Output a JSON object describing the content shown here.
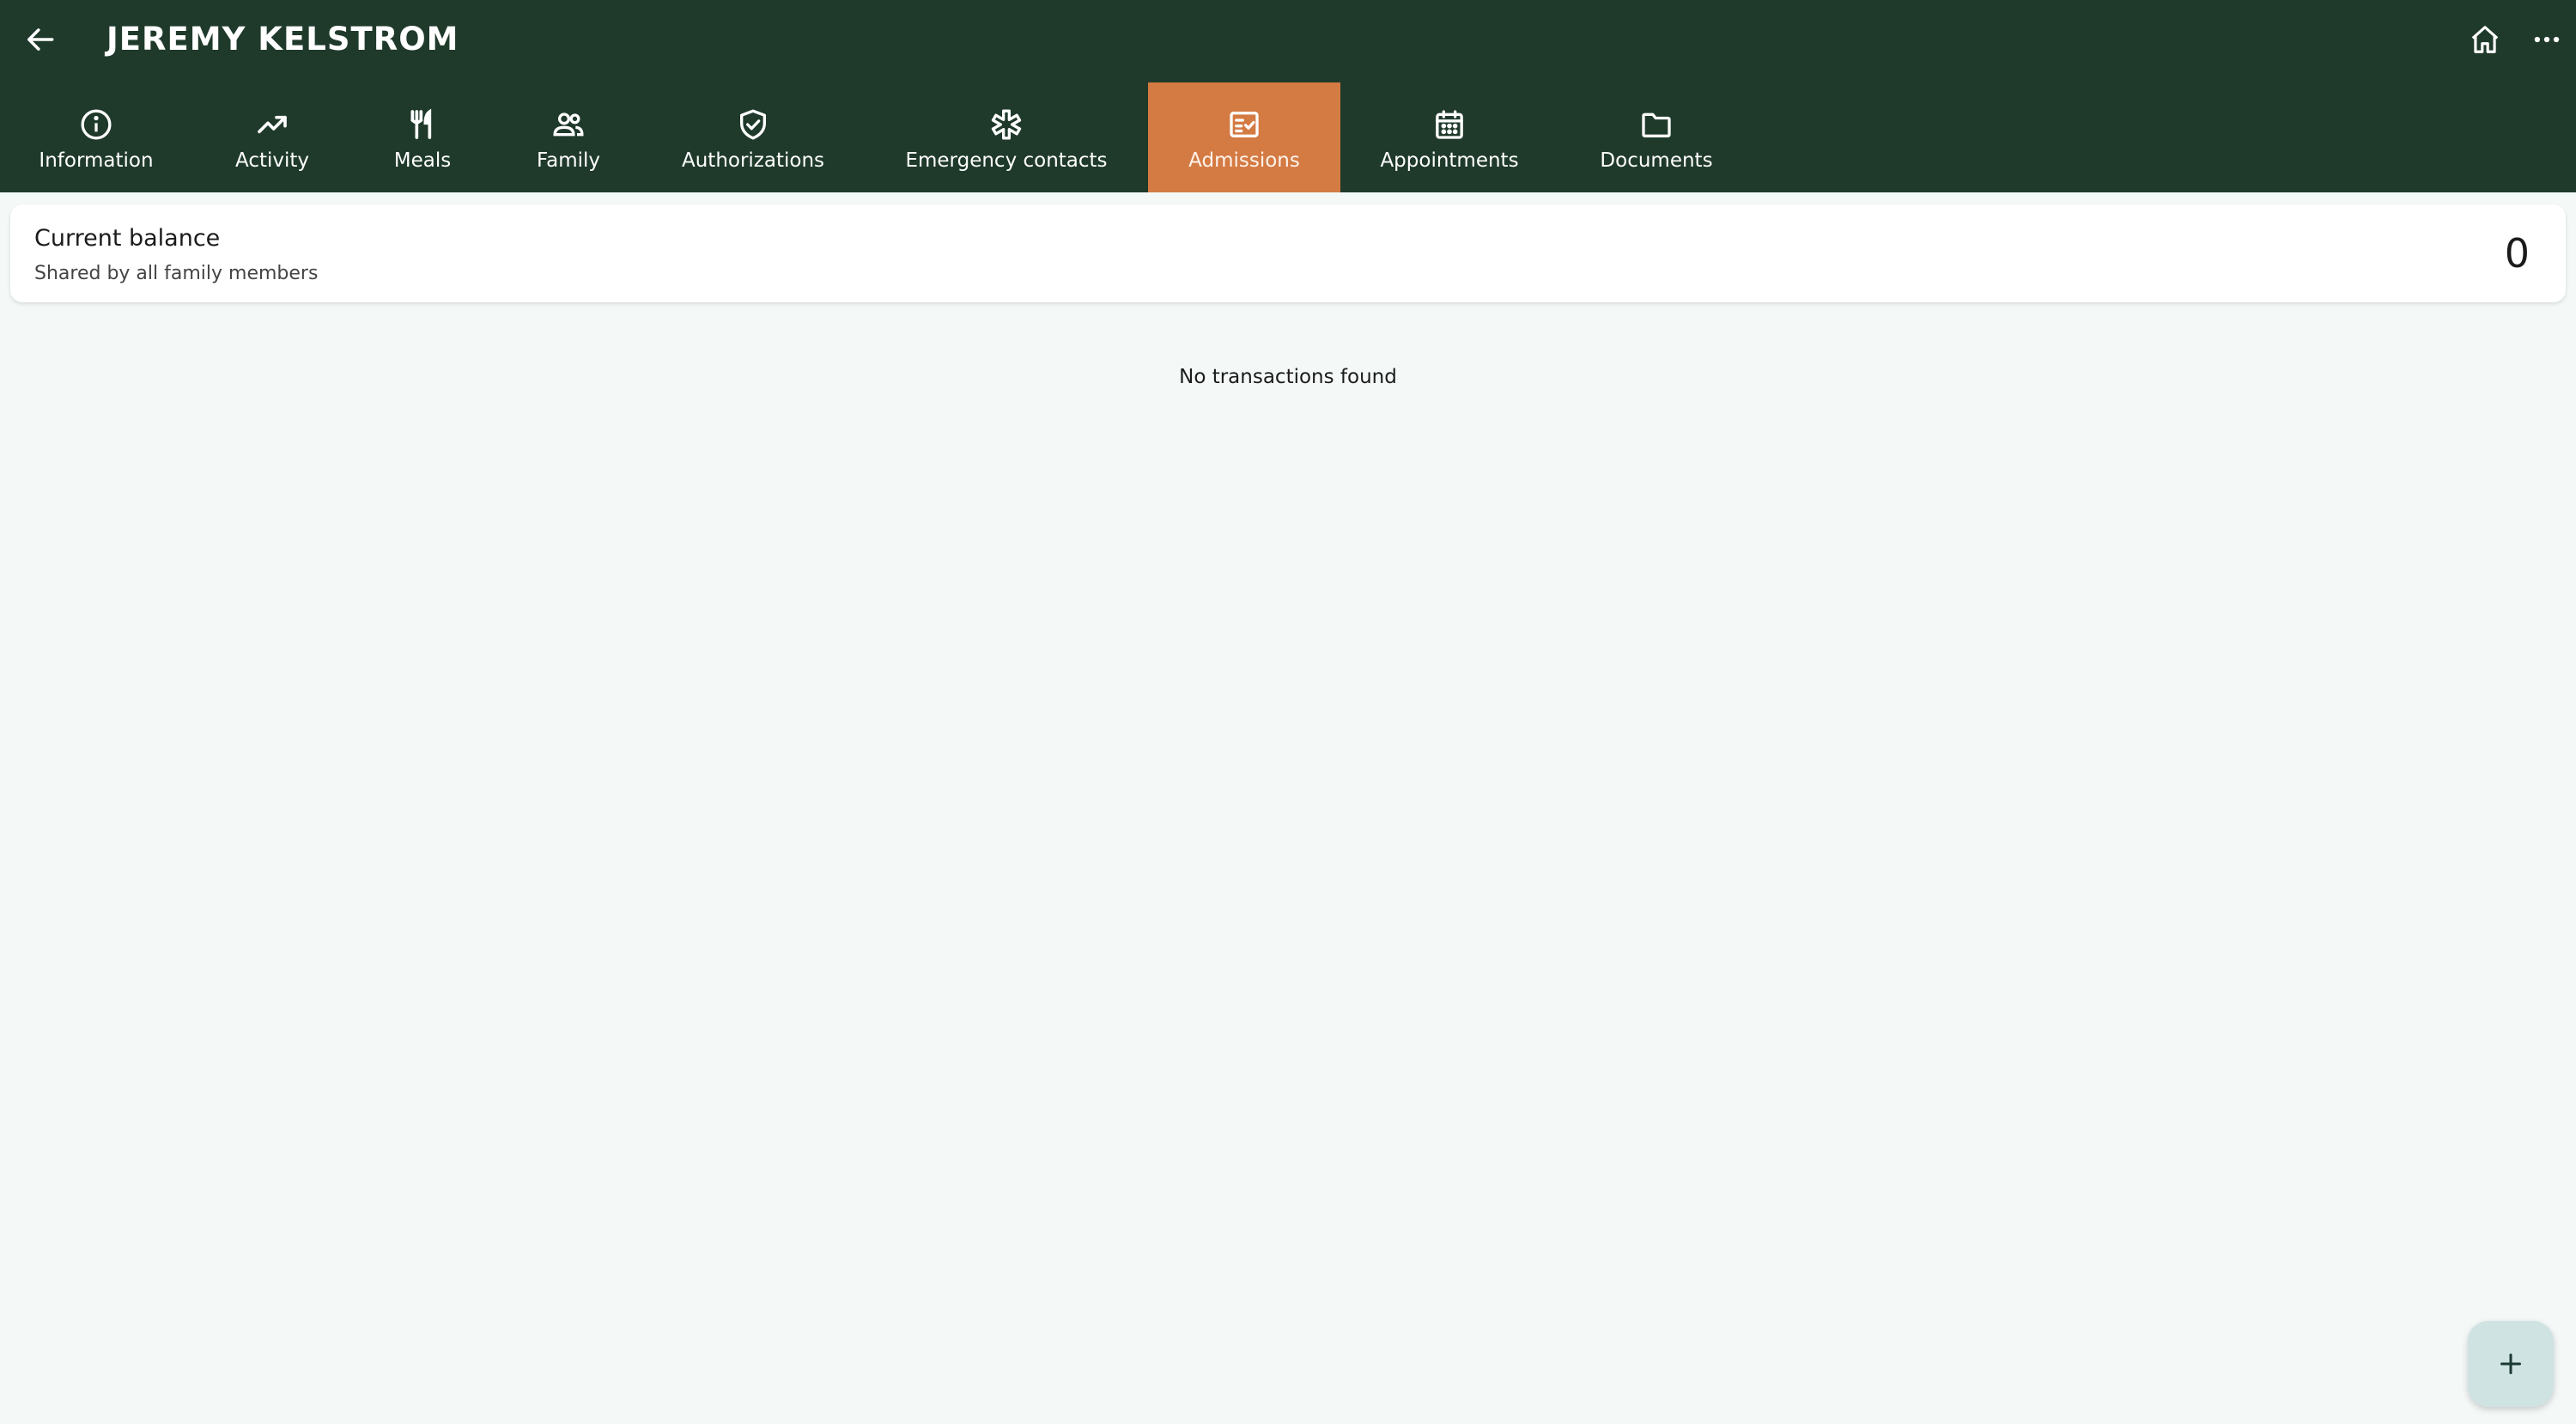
{
  "header": {
    "title": "JEREMY KELSTROM",
    "back_icon": "arrow-left-icon",
    "home_icon": "home-icon",
    "more_icon": "more-horizontal-icon"
  },
  "tabs": [
    {
      "label": "Information",
      "icon": "info-icon",
      "active": false
    },
    {
      "label": "Activity",
      "icon": "trending-up-icon",
      "active": false
    },
    {
      "label": "Meals",
      "icon": "utensils-icon",
      "active": false
    },
    {
      "label": "Family",
      "icon": "people-icon",
      "active": false
    },
    {
      "label": "Authorizations",
      "icon": "shield-check-icon",
      "active": false
    },
    {
      "label": "Emergency contacts",
      "icon": "medical-asterisk-icon",
      "active": false
    },
    {
      "label": "Admissions",
      "icon": "checklist-icon",
      "active": true
    },
    {
      "label": "Appointments",
      "icon": "calendar-icon",
      "active": false
    },
    {
      "label": "Documents",
      "icon": "folder-icon",
      "active": false
    }
  ],
  "balance": {
    "title": "Current balance",
    "subtitle": "Shared by all family members",
    "value": "0"
  },
  "transactions": {
    "empty_message": "No transactions found"
  },
  "fab": {
    "icon": "plus-icon"
  },
  "colors": {
    "header_bg": "#1f3a2b",
    "active_tab": "#d47a43",
    "page_bg": "#f4f8f7",
    "fab_bg": "#cfe3e2"
  }
}
